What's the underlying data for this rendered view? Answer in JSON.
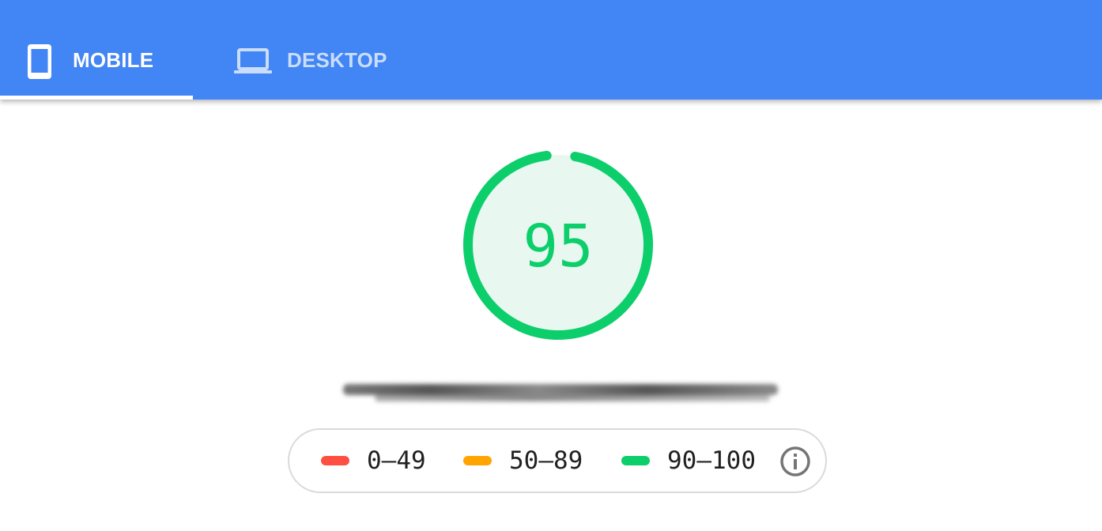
{
  "tabs": [
    {
      "label": "MOBILE",
      "icon": "smartphone-icon",
      "selected": true
    },
    {
      "label": "DESKTOP",
      "icon": "laptop-icon",
      "selected": false
    }
  ],
  "score": {
    "value": "95",
    "fraction": 0.95,
    "color": "#0cce6b"
  },
  "legend": {
    "items": [
      {
        "label": "0–49",
        "color": "#ff4e42"
      },
      {
        "label": "50–89",
        "color": "#ffa400"
      },
      {
        "label": "90–100",
        "color": "#0cce6b"
      }
    ],
    "info_icon": "info-icon"
  },
  "colors": {
    "header_bg": "#4285f4",
    "tab_active": "#ffffff",
    "gauge_fill": "#e8f8f0"
  }
}
